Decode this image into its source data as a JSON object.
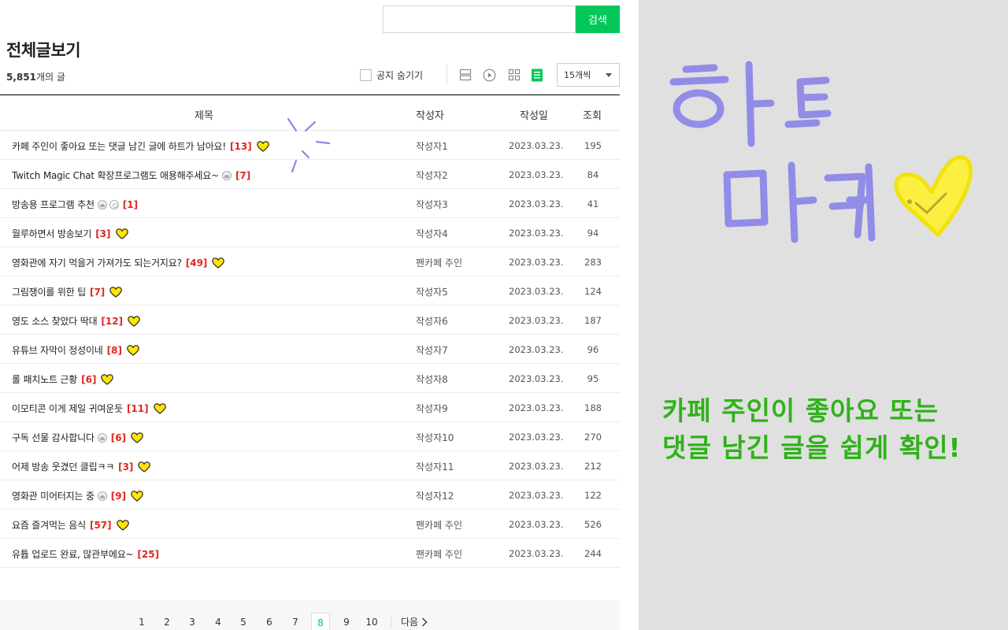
{
  "search": {
    "placeholder": "",
    "button_label": "검색"
  },
  "board": {
    "title": "전체글보기",
    "count_number": "5,851",
    "count_suffix": "개의 글",
    "notice_toggle_label": "공지 숨기기",
    "per_page_value": "15개씩",
    "view_icons": [
      "list-view-icon",
      "play-view-icon",
      "grid-view-icon",
      "board-view-icon"
    ],
    "active_view": "board-view-icon"
  },
  "table": {
    "headers": {
      "title": "제목",
      "author": "작성자",
      "date": "작성일",
      "views": "조회"
    },
    "rows": [
      {
        "title": "카페 주인이 좋아요 또는 댓글 남긴 글에 하트가 남아요!",
        "comments": "[13]",
        "icons": [],
        "heart": true,
        "author": "작성자1",
        "date": "2023.03.23.",
        "views": "195"
      },
      {
        "title": "Twitch Magic Chat 확장프로그램도 애용해주세요~",
        "comments": "[7]",
        "icons": [
          "image"
        ],
        "heart": false,
        "author": "작성자2",
        "date": "2023.03.23.",
        "views": "84"
      },
      {
        "title": "방송용 프로그램 추천",
        "comments": "[1]",
        "icons": [
          "image",
          "link"
        ],
        "heart": false,
        "author": "작성자3",
        "date": "2023.03.23.",
        "views": "41"
      },
      {
        "title": "월루하면서 방송보기",
        "comments": "[3]",
        "icons": [],
        "heart": true,
        "author": "작성자4",
        "date": "2023.03.23.",
        "views": "94"
      },
      {
        "title": "영화관에 자기 먹을거 가져가도 되는거지요?",
        "comments": "[49]",
        "icons": [],
        "heart": true,
        "author": "팬카페 주인",
        "date": "2023.03.23.",
        "views": "283"
      },
      {
        "title": "그림쟁이를 위한 팁",
        "comments": "[7]",
        "icons": [],
        "heart": true,
        "author": "작성자5",
        "date": "2023.03.23.",
        "views": "124"
      },
      {
        "title": "영도 소스 찾았다 딱대",
        "comments": "[12]",
        "icons": [],
        "heart": true,
        "author": "작성자6",
        "date": "2023.03.23.",
        "views": "187"
      },
      {
        "title": "유튜브 자막이 정성이네",
        "comments": "[8]",
        "icons": [],
        "heart": true,
        "author": "작성자7",
        "date": "2023.03.23.",
        "views": "96"
      },
      {
        "title": "롤 패치노트 근황",
        "comments": "[6]",
        "icons": [],
        "heart": true,
        "author": "작성자8",
        "date": "2023.03.23.",
        "views": "95"
      },
      {
        "title": "이모티콘 이게 제일 귀여운듯",
        "comments": "[11]",
        "icons": [],
        "heart": true,
        "author": "작성자9",
        "date": "2023.03.23.",
        "views": "188"
      },
      {
        "title": "구독 선물 감사합니다",
        "comments": "[6]",
        "icons": [
          "image"
        ],
        "heart": true,
        "author": "작성자10",
        "date": "2023.03.23.",
        "views": "270"
      },
      {
        "title": "어제 방송 웃겼던 클립ㅋㅋ",
        "comments": "[3]",
        "icons": [],
        "heart": true,
        "author": "작성자11",
        "date": "2023.03.23.",
        "views": "212"
      },
      {
        "title": "영화관 미어터지는 중",
        "comments": "[9]",
        "icons": [
          "image"
        ],
        "heart": true,
        "author": "작성자12",
        "date": "2023.03.23.",
        "views": "122"
      },
      {
        "title": "요즘 즐겨먹는 음식",
        "comments": "[57]",
        "icons": [],
        "heart": true,
        "author": "팬카페 주인",
        "date": "2023.03.23.",
        "views": "526"
      },
      {
        "title": "유튭 업로드 완료, 많관부에요~",
        "comments": "[25]",
        "icons": [],
        "heart": false,
        "author": "팬카페 주인",
        "date": "2023.03.23.",
        "views": "244"
      }
    ]
  },
  "pagination": {
    "pages": [
      "1",
      "2",
      "3",
      "4",
      "5",
      "6",
      "7",
      "8",
      "9",
      "10"
    ],
    "current": "8",
    "next_label": "다음"
  },
  "promo": {
    "handwritten_title_line1": "하트",
    "handwritten_title_line2": "마커",
    "caption_line1": "카페 주인이 좋아요 또는",
    "caption_line2": "댓글 남긴 글을 쉽게 확인!"
  },
  "colors": {
    "accent": "#03c75a",
    "comment_count": "#e0261f",
    "heart_fill": "#ffe600",
    "handwriting_purple": "#8b85e8",
    "caption_green": "#2fb21a",
    "side_panel_bg": "#e0e0e0"
  }
}
